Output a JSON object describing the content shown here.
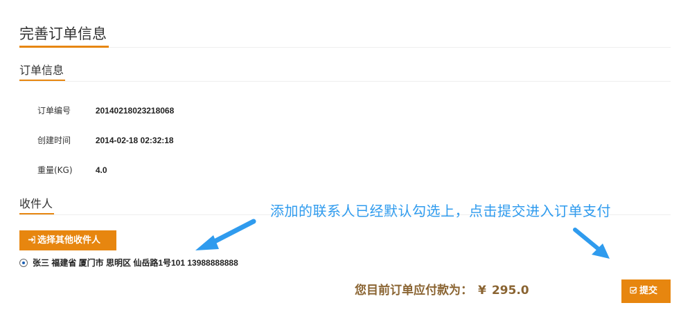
{
  "page_title": "完善订单信息",
  "order_section": {
    "title": "订单信息",
    "rows": [
      {
        "label": "订单编号",
        "value": "20140218023218068"
      },
      {
        "label": "创建时间",
        "value": "2014-02-18 02:32:18"
      },
      {
        "label": "重量(KG)",
        "value": "4.0"
      }
    ]
  },
  "recipient_section": {
    "title": "收件人",
    "choose_button_label": "选择其他收件人",
    "choose_button_icon": "sign-in-icon",
    "contacts": [
      {
        "text": "张三 福建省 厦门市 思明区 仙岳路1号101 13988888888",
        "selected": true
      }
    ]
  },
  "annotation": {
    "text": "添加的联系人已经默认勾选上，点击提交进入订单支付",
    "color": "#2f9bee"
  },
  "payment": {
    "label": "您目前订单应付款为：",
    "currency": "¥",
    "amount": "295.0"
  },
  "submit_button": {
    "label": "提交",
    "icon": "check-square-icon"
  },
  "colors": {
    "accent": "#e7860f",
    "total_text": "#8a6432",
    "annotation": "#2f9bee"
  }
}
